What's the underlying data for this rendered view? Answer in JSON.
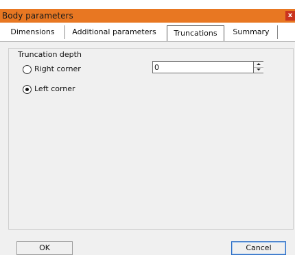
{
  "window": {
    "title": "Body parameters",
    "close_label": "x"
  },
  "tabs": [
    {
      "label": "Dimensions",
      "active": false
    },
    {
      "label": "Additional parameters",
      "active": false
    },
    {
      "label": "Truncations",
      "active": true
    },
    {
      "label": "Summary",
      "active": false
    }
  ],
  "truncation_group": {
    "legend": "Truncation depth",
    "right_corner_label": "Right corner",
    "right_corner_selected": false,
    "left_corner_label": "Left corner",
    "left_corner_selected": true,
    "depth_value": "0"
  },
  "buttons": {
    "ok_label": "OK",
    "cancel_label": "Cancel"
  },
  "colors": {
    "titlebar": "#e87722",
    "close_button": "#c9341f",
    "focus_border": "#2b6cc4"
  },
  "icons": {
    "close": "close-icon",
    "spin_up": "chevron-up-icon",
    "spin_down": "chevron-down-icon"
  }
}
